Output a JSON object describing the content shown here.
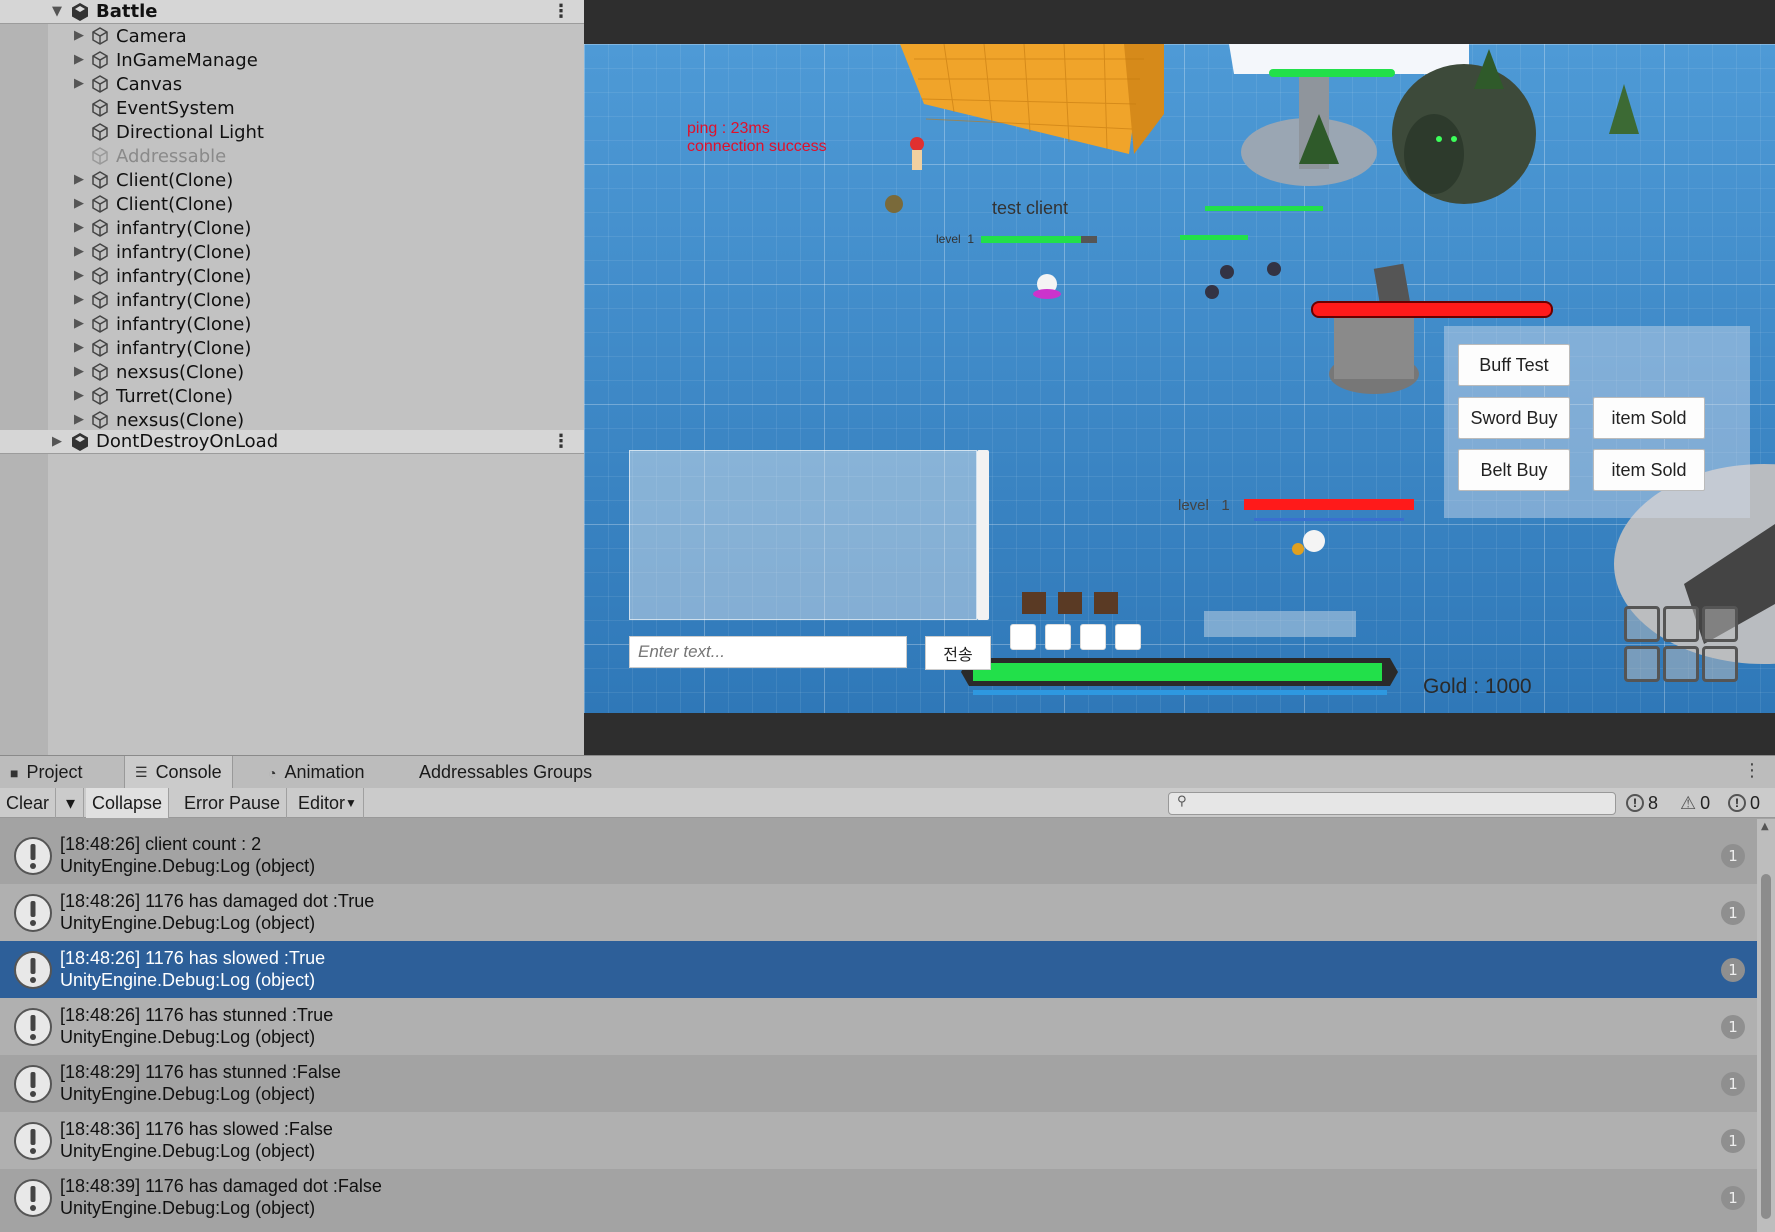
{
  "hierarchy": {
    "scene_name": "Battle",
    "items": [
      {
        "label": "Camera"
      },
      {
        "label": "InGameManage"
      },
      {
        "label": "Canvas"
      },
      {
        "label": "EventSystem"
      },
      {
        "label": "Directional Light"
      },
      {
        "label": "Addressable"
      },
      {
        "label": "Client(Clone)"
      },
      {
        "label": "Client(Clone)"
      },
      {
        "label": "infantry(Clone)"
      },
      {
        "label": "infantry(Clone)"
      },
      {
        "label": "infantry(Clone)"
      },
      {
        "label": "infantry(Clone)"
      },
      {
        "label": "infantry(Clone)"
      },
      {
        "label": "infantry(Clone)"
      },
      {
        "label": "nexsus(Clone)"
      },
      {
        "label": "Turret(Clone)"
      },
      {
        "label": "nexsus(Clone)"
      }
    ],
    "dont_destroy": "DontDestroyOnLoad"
  },
  "game": {
    "ping_line1": "ping : 23ms",
    "ping_line2": "connection success",
    "player_name": "test client",
    "level_small_label": "level",
    "level_small_value": "1",
    "level_label": "level",
    "level_value": "1",
    "chat_placeholder": "Enter text...",
    "chat_send": "전송",
    "buff_test": "Buff Test",
    "sword_buy": "Sword Buy",
    "belt_buy": "Belt Buy",
    "item_sold_1": "item Sold",
    "item_sold_2": "item Sold",
    "gold": "Gold : 1000",
    "health_fraction": 0.87
  },
  "console": {
    "tabs": [
      "Project",
      "Console",
      "Animation",
      "Addressables Groups"
    ],
    "toolbar": {
      "clear": "Clear",
      "collapse": "Collapse",
      "error_pause": "Error Pause",
      "editor": "Editor"
    },
    "counts": {
      "log": "8",
      "warn": "0",
      "error": "0"
    },
    "logs": [
      {
        "line1": "[18:48:26] client count : 2",
        "line2": "UnityEngine.Debug:Log (object)",
        "count": "1"
      },
      {
        "line1": "[18:48:26] 1176 has damaged dot :True",
        "line2": "UnityEngine.Debug:Log (object)",
        "count": "1"
      },
      {
        "line1": "[18:48:26] 1176 has slowed :True",
        "line2": "UnityEngine.Debug:Log (object)",
        "count": "1"
      },
      {
        "line1": "[18:48:26] 1176 has stunned :True",
        "line2": "UnityEngine.Debug:Log (object)",
        "count": "1"
      },
      {
        "line1": "[18:48:29] 1176 has stunned :False",
        "line2": "UnityEngine.Debug:Log (object)",
        "count": "1"
      },
      {
        "line1": "[18:48:36] 1176 has slowed :False",
        "line2": "UnityEngine.Debug:Log (object)",
        "count": "1"
      },
      {
        "line1": "[18:48:39] 1176 has damaged dot :False",
        "line2": "UnityEngine.Debug:Log (object)",
        "count": "1"
      }
    ]
  },
  "colors": {
    "selection": "#2d5f99",
    "ping_text": "#e0102a",
    "health_green": "#22e04a",
    "enemy_red": "#ff1a1a"
  }
}
